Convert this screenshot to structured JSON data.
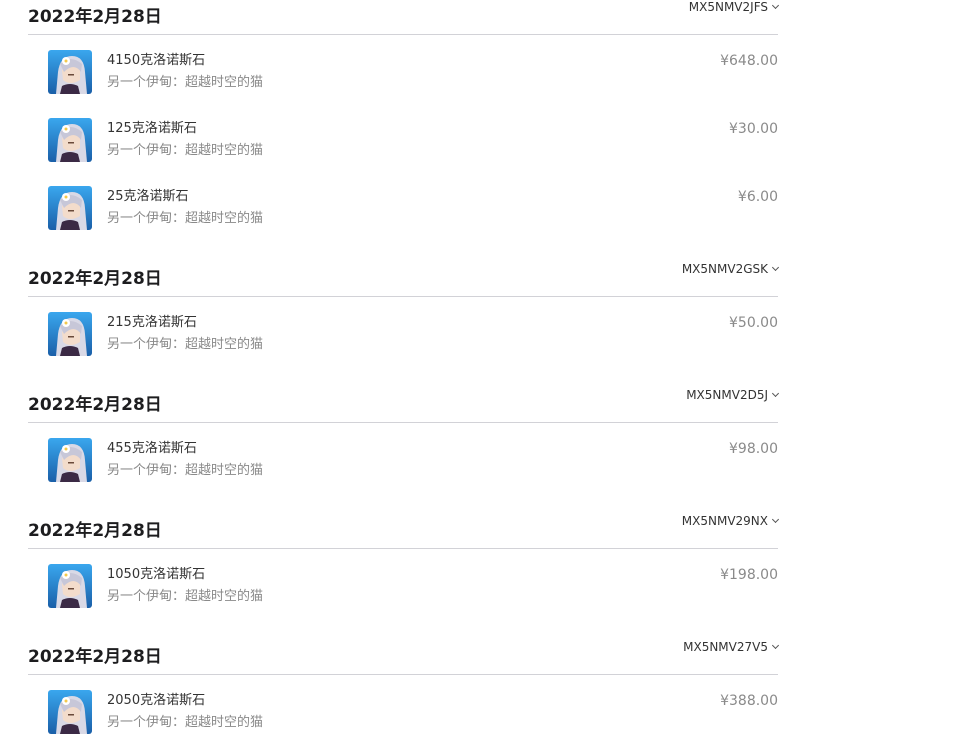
{
  "currency_symbol": "¥",
  "groups": [
    {
      "date": "2022年2月28日",
      "order_id": "MX5NMV2JFS",
      "items": [
        {
          "title": "4150克洛诺斯石",
          "subtitle": "另一个伊甸：超越时空的猫",
          "price": "¥648.00",
          "icon": "game-character-icon"
        },
        {
          "title": "125克洛诺斯石",
          "subtitle": "另一个伊甸：超越时空的猫",
          "price": "¥30.00",
          "icon": "game-character-icon"
        },
        {
          "title": "25克洛诺斯石",
          "subtitle": "另一个伊甸：超越时空的猫",
          "price": "¥6.00",
          "icon": "game-character-icon"
        }
      ]
    },
    {
      "date": "2022年2月28日",
      "order_id": "MX5NMV2GSK",
      "items": [
        {
          "title": "215克洛诺斯石",
          "subtitle": "另一个伊甸：超越时空的猫",
          "price": "¥50.00",
          "icon": "game-character-icon"
        }
      ]
    },
    {
      "date": "2022年2月28日",
      "order_id": "MX5NMV2D5J",
      "items": [
        {
          "title": "455克洛诺斯石",
          "subtitle": "另一个伊甸：超越时空的猫",
          "price": "¥98.00",
          "icon": "game-character-icon"
        }
      ]
    },
    {
      "date": "2022年2月28日",
      "order_id": "MX5NMV29NX",
      "items": [
        {
          "title": "1050克洛诺斯石",
          "subtitle": "另一个伊甸：超越时空的猫",
          "price": "¥198.00",
          "icon": "game-character-icon"
        }
      ]
    },
    {
      "date": "2022年2月28日",
      "order_id": "MX5NMV27V5",
      "items": [
        {
          "title": "2050克洛诺斯石",
          "subtitle": "另一个伊甸：超越时空的猫",
          "price": "¥388.00",
          "icon": "game-character-icon"
        }
      ]
    }
  ],
  "colors": {
    "divider": "#d2d2d7",
    "heading": "#1d1d1f",
    "muted": "#8a8a8a",
    "icon_bg": "#2a8fd8"
  }
}
